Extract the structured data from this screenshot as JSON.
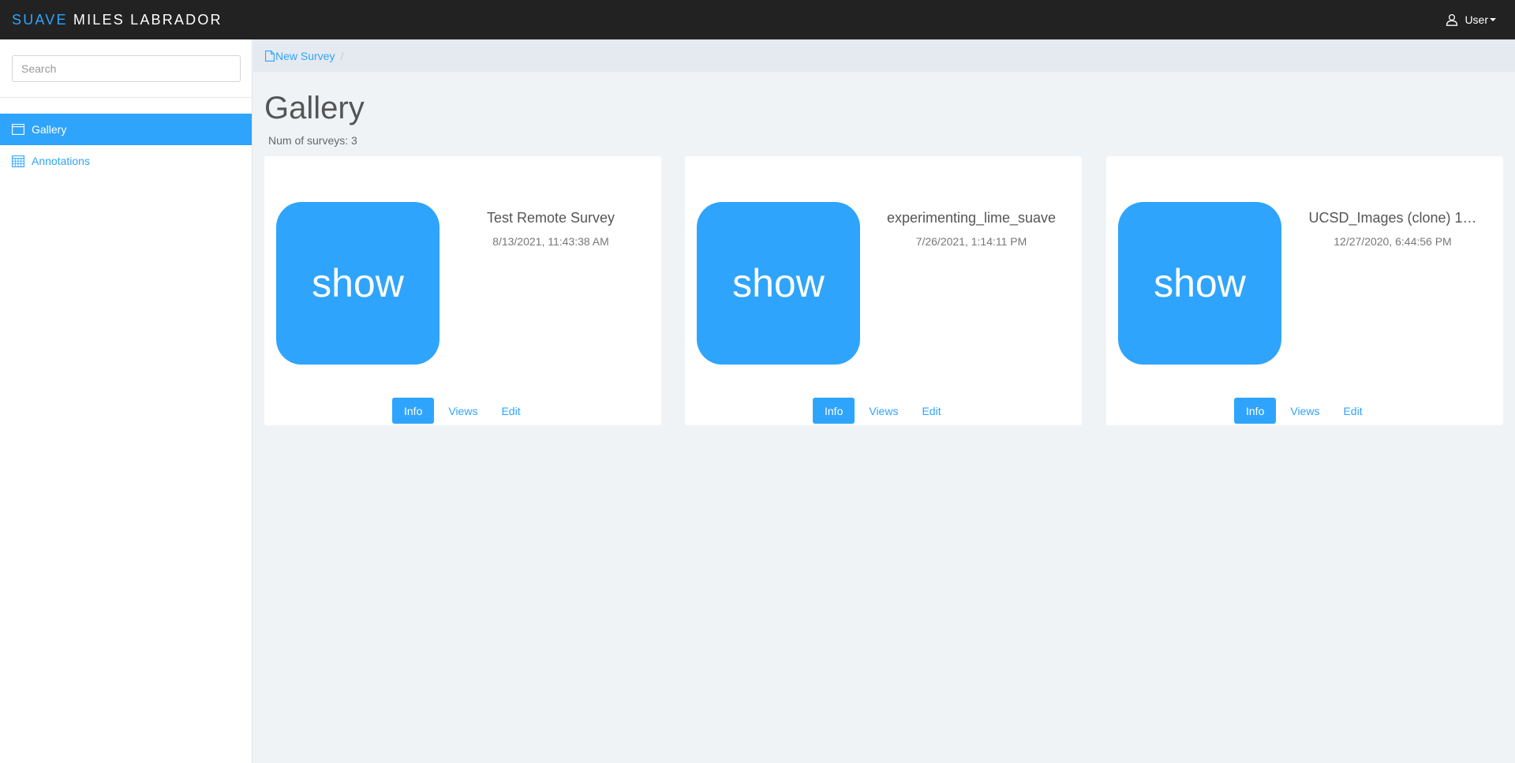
{
  "colors": {
    "accent": "#2fa4fc",
    "topbar": "#222222",
    "background": "#eff3f6"
  },
  "header": {
    "brand_accent": "SUAVE",
    "brand_name": "MILES LABRADOR",
    "user_label": "User",
    "user_icon": "user-icon"
  },
  "sidebar": {
    "search_placeholder": "Search",
    "items": [
      {
        "label": "Gallery",
        "icon": "window-icon",
        "active": true
      },
      {
        "label": "Annotations",
        "icon": "calendar-icon",
        "active": false
      }
    ]
  },
  "breadcrumb": {
    "link_label": "New Survey",
    "link_icon": "file-icon",
    "separator": "/"
  },
  "main": {
    "title": "Gallery",
    "count_text": "Num of surveys: 3",
    "cards": [
      {
        "thumb_label": "show",
        "title": "Test Remote Survey",
        "date": "8/13/2021, 11:43:38 AM",
        "buttons": [
          "Info",
          "Views",
          "Edit"
        ]
      },
      {
        "thumb_label": "show",
        "title": "experimenting_lime_suave",
        "date": "7/26/2021, 1:14:11 PM",
        "buttons": [
          "Info",
          "Views",
          "Edit"
        ]
      },
      {
        "thumb_label": "show",
        "title": "UCSD_Images (clone) 1…",
        "date": "12/27/2020, 6:44:56 PM",
        "buttons": [
          "Info",
          "Views",
          "Edit"
        ]
      }
    ]
  }
}
